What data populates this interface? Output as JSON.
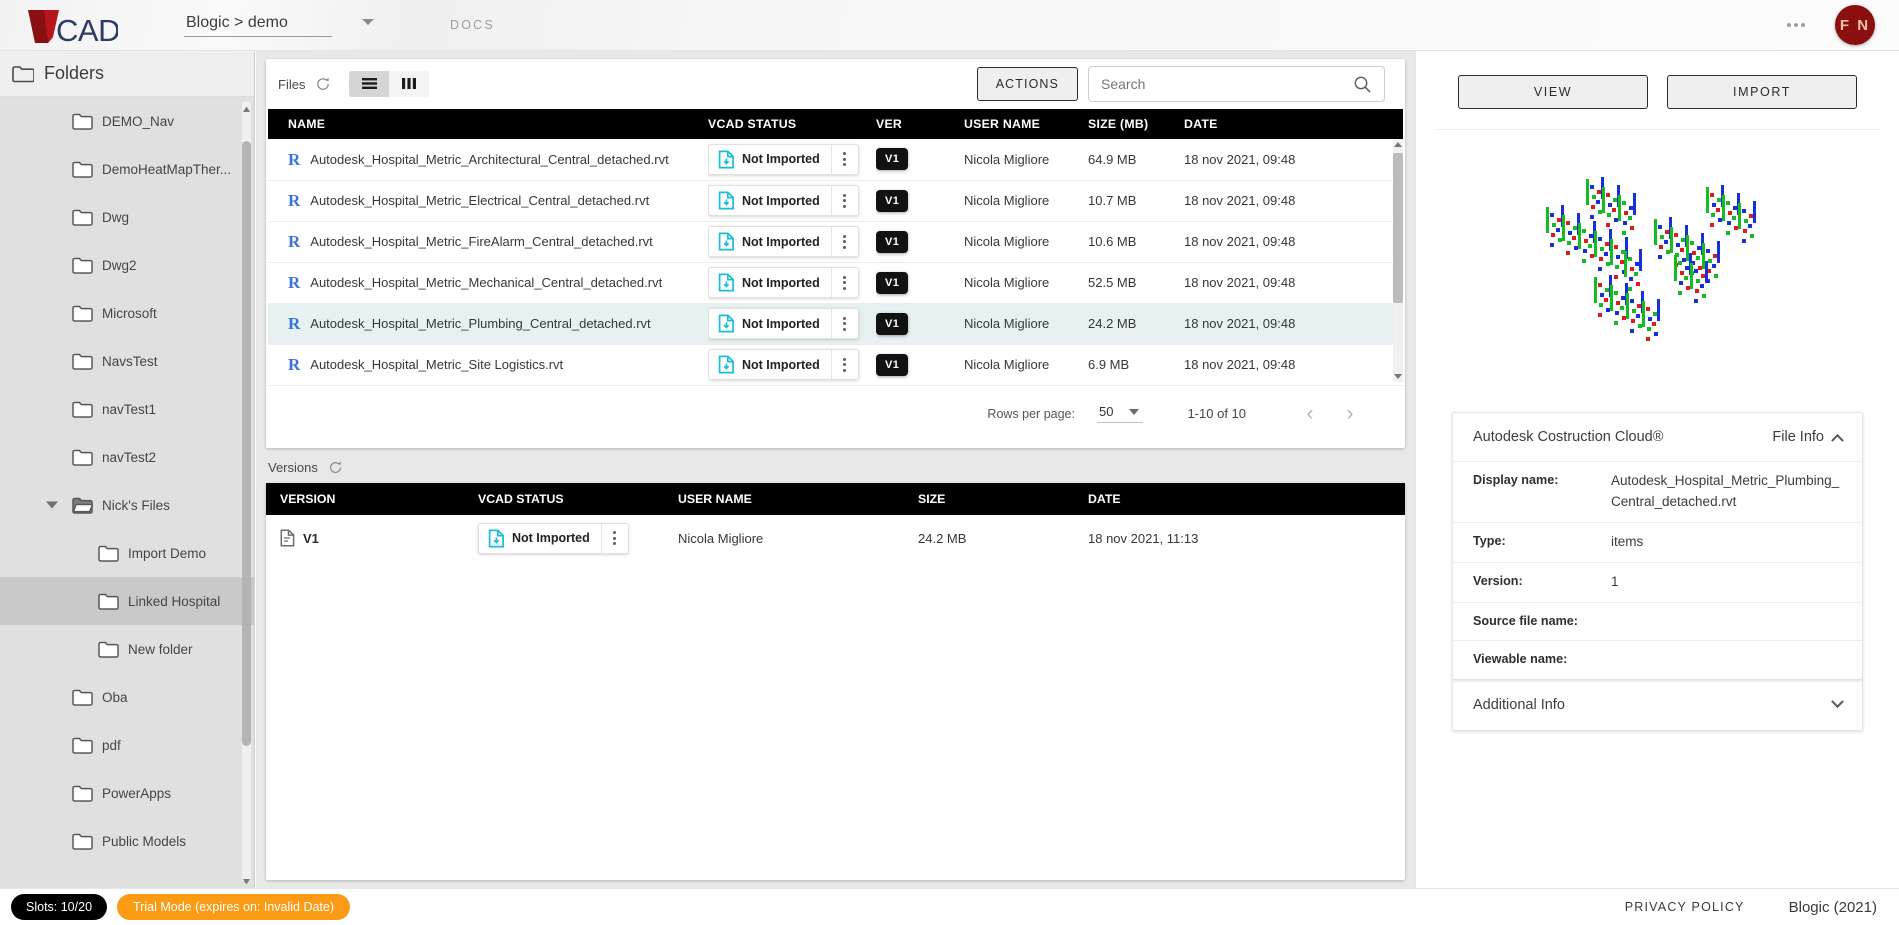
{
  "topbar": {
    "logo_text": "VCAD",
    "project_selector": "Blogic > demo",
    "docs_label": "DOCS",
    "avatar_initials": "F N"
  },
  "sidebar": {
    "title": "Folders",
    "items": [
      {
        "label": "DEMO_Nav",
        "depth": 0,
        "selected": false,
        "expanded": false
      },
      {
        "label": "DemoHeatMapTher...",
        "depth": 0,
        "selected": false,
        "expanded": false
      },
      {
        "label": "Dwg",
        "depth": 0,
        "selected": false,
        "expanded": false
      },
      {
        "label": "Dwg2",
        "depth": 0,
        "selected": false,
        "expanded": false
      },
      {
        "label": "Microsoft",
        "depth": 0,
        "selected": false,
        "expanded": false
      },
      {
        "label": "NavsTest",
        "depth": 0,
        "selected": false,
        "expanded": false
      },
      {
        "label": "navTest1",
        "depth": 0,
        "selected": false,
        "expanded": false
      },
      {
        "label": "navTest2",
        "depth": 0,
        "selected": false,
        "expanded": false
      },
      {
        "label": "Nick's Files",
        "depth": 0,
        "selected": false,
        "expanded": true
      },
      {
        "label": "Import Demo",
        "depth": 1,
        "selected": false,
        "expanded": false
      },
      {
        "label": "Linked Hospital",
        "depth": 1,
        "selected": true,
        "expanded": false
      },
      {
        "label": "New folder",
        "depth": 1,
        "selected": false,
        "expanded": false
      },
      {
        "label": "Oba",
        "depth": 0,
        "selected": false,
        "expanded": false
      },
      {
        "label": "pdf",
        "depth": 0,
        "selected": false,
        "expanded": false
      },
      {
        "label": "PowerApps",
        "depth": 0,
        "selected": false,
        "expanded": false
      },
      {
        "label": "Public Models",
        "depth": 0,
        "selected": false,
        "expanded": false
      }
    ]
  },
  "files": {
    "section_label": "Files",
    "actions_label": "ACTIONS",
    "search_placeholder": "Search",
    "search_value": "",
    "columns": [
      "NAME",
      "VCAD STATUS",
      "VER",
      "USER NAME",
      "SIZE (MB)",
      "DATE"
    ],
    "rows": [
      {
        "name": "Autodesk_Hospital_Metric_Architectural_Central_detached.rvt",
        "status": "Not Imported",
        "ver": "V1",
        "user": "Nicola Migliore",
        "size": "64.9 MB",
        "date": "18 nov 2021, 09:48",
        "selected": false
      },
      {
        "name": "Autodesk_Hospital_Metric_Electrical_Central_detached.rvt",
        "status": "Not Imported",
        "ver": "V1",
        "user": "Nicola Migliore",
        "size": "10.7 MB",
        "date": "18 nov 2021, 09:48",
        "selected": false
      },
      {
        "name": "Autodesk_Hospital_Metric_FireAlarm_Central_detached.rvt",
        "status": "Not Imported",
        "ver": "V1",
        "user": "Nicola Migliore",
        "size": "10.6 MB",
        "date": "18 nov 2021, 09:48",
        "selected": false
      },
      {
        "name": "Autodesk_Hospital_Metric_Mechanical_Central_detached.rvt",
        "status": "Not Imported",
        "ver": "V1",
        "user": "Nicola Migliore",
        "size": "52.5 MB",
        "date": "18 nov 2021, 09:48",
        "selected": false
      },
      {
        "name": "Autodesk_Hospital_Metric_Plumbing_Central_detached.rvt",
        "status": "Not Imported",
        "ver": "V1",
        "user": "Nicola Migliore",
        "size": "24.2 MB",
        "date": "18 nov 2021, 09:48",
        "selected": true
      },
      {
        "name": "Autodesk_Hospital_Metric_Site Logistics.rvt",
        "status": "Not Imported",
        "ver": "V1",
        "user": "Nicola Migliore",
        "size": "6.9 MB",
        "date": "18 nov 2021, 09:48",
        "selected": false
      }
    ],
    "paginator": {
      "rows_per_page_label": "Rows per page:",
      "rows_per_page_value": "50",
      "range_label": "1-10 of 10"
    }
  },
  "versions": {
    "section_label": "Versions",
    "columns": [
      "VERSION",
      "VCAD STATUS",
      "USER NAME",
      "SIZE",
      "DATE"
    ],
    "rows": [
      {
        "version": "V1",
        "status": "Not Imported",
        "user": "Nicola Migliore",
        "size": "24.2 MB",
        "date": "18 nov 2021, 11:13"
      }
    ]
  },
  "rightpane": {
    "view_label": "VIEW",
    "import_label": "IMPORT",
    "source_label": "Autodesk Costruction Cloud®",
    "fileinfo_label": "File Info",
    "additional_info_label": "Additional Info",
    "info_rows": [
      {
        "key": "Display name:",
        "value": "Autodesk_Hospital_Metric_Plumbing_Central_detached.rvt"
      },
      {
        "key": "Type:",
        "value": "items"
      },
      {
        "key": "Version:",
        "value": "1"
      },
      {
        "key": "Source file name:",
        "value": ""
      },
      {
        "key": "Viewable name:",
        "value": ""
      }
    ]
  },
  "footer": {
    "slots_label": "Slots: 10/20",
    "trial_label": "Trial Mode (expires on: Invalid Date)",
    "privacy_label": "PRIVACY POLICY",
    "brand_label": "Blogic (2021)"
  }
}
